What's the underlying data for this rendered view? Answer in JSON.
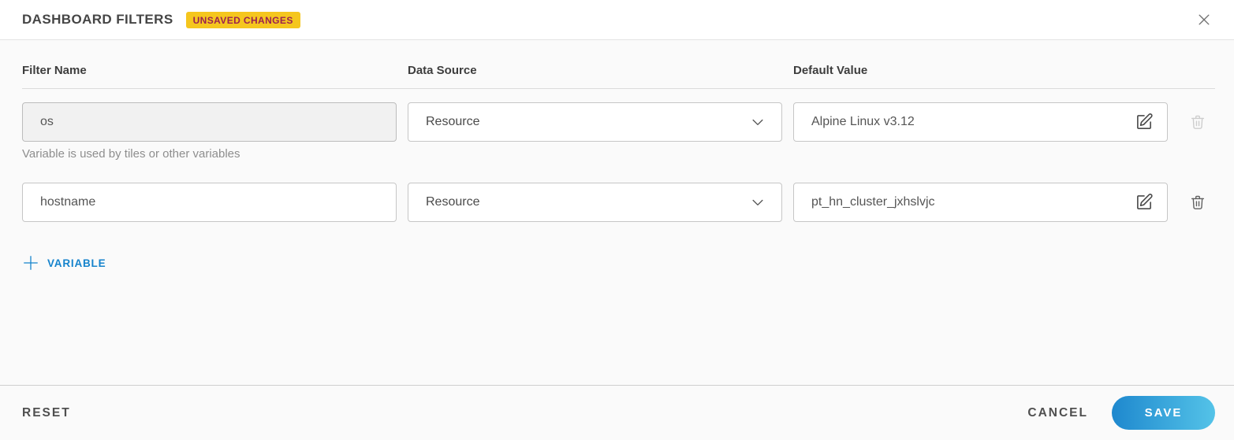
{
  "header": {
    "title": "DASHBOARD FILTERS",
    "badge": "UNSAVED CHANGES"
  },
  "columns": {
    "filter_name": "Filter Name",
    "data_source": "Data Source",
    "default_value": "Default Value"
  },
  "rows": [
    {
      "filter_name": "os",
      "data_source": "Resource",
      "default_value": "Alpine Linux v3.12",
      "helper_text": "Variable is used by tiles or other variables"
    },
    {
      "filter_name": "hostname",
      "data_source": "Resource",
      "default_value": "pt_hn_cluster_jxhslvjc"
    }
  ],
  "actions": {
    "add_variable_label": "VARIABLE"
  },
  "footer": {
    "reset_label": "RESET",
    "cancel_label": "CANCEL",
    "save_label": "SAVE"
  },
  "colors": {
    "accent_blue": "#1583cc",
    "badge_bg": "#f5c61e",
    "badge_text": "#9b2150",
    "save_gradient_start": "#1e88ce",
    "save_gradient_end": "#54c3e8"
  }
}
